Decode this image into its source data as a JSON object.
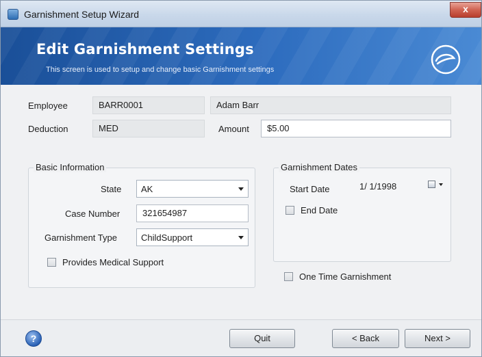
{
  "window": {
    "title": "Garnishment Setup Wizard",
    "close_glyph": "x"
  },
  "banner": {
    "title": "Edit Garnishment Settings",
    "subtitle": "This screen is used to setup and change basic Garnishment settings"
  },
  "employee": {
    "label": "Employee",
    "id": "BARR0001",
    "name": "Adam Barr"
  },
  "deduction": {
    "label": "Deduction",
    "value": "MED"
  },
  "amount": {
    "label": "Amount",
    "value": "$5.00"
  },
  "basic_info": {
    "title": "Basic Information",
    "state_label": "State",
    "state_value": "AK",
    "case_label": "Case Number",
    "case_value": "321654987",
    "type_label": "Garnishment Type",
    "type_value": "ChildSupport",
    "medical_label": "Provides Medical Support",
    "medical_checked": false
  },
  "dates": {
    "title": "Garnishment Dates",
    "start_label": "Start Date",
    "start_value": "1/ 1/1998",
    "end_label": "End Date",
    "end_checked": false
  },
  "one_time": {
    "label": "One Time Garnishment",
    "checked": false
  },
  "footer": {
    "quit": "Quit",
    "back": "< Back",
    "next": "Next >",
    "help_glyph": "?"
  }
}
